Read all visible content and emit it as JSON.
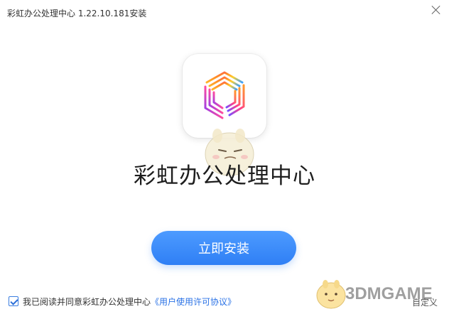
{
  "window": {
    "title": "彩虹办公处理中心 1.22.10.181安装"
  },
  "app": {
    "name": "彩虹办公处理中心"
  },
  "actions": {
    "install_label": "立即安装",
    "custom_label": "自定义"
  },
  "agreement": {
    "checked": true,
    "text": "我已阅读并同意彩虹办公处理中心",
    "link": "《用户使用许可协议》"
  },
  "watermark": {
    "text": "3DMGAME"
  },
  "colors": {
    "accent": "#3a8bff",
    "link": "#2a72e6"
  }
}
